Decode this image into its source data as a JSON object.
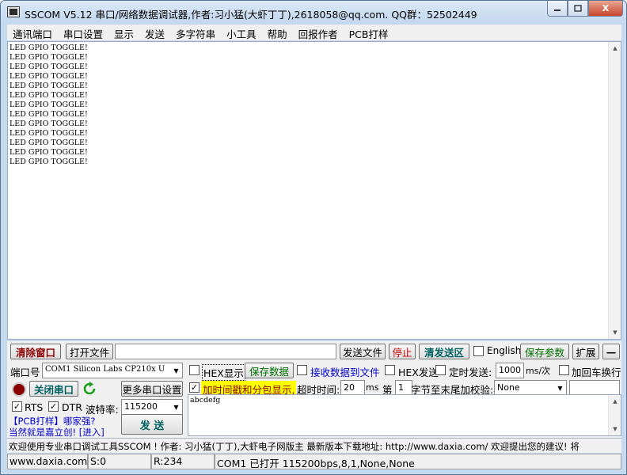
{
  "window": {
    "title": "SSCOM V5.12 串口/网络数据调试器,作者:习小猛(大虾丁丁),2618058@qq.com. QQ群：52502449",
    "minimize_icon": "minimize-icon",
    "maximize_icon": "maximize-icon",
    "close_label": "X"
  },
  "menu": [
    "通讯端口",
    "串口设置",
    "显示",
    "发送",
    "多字符串",
    "小工具",
    "帮助",
    "回报作者",
    "PCB打样"
  ],
  "receive": {
    "lines": [
      "LED GPIO TOGGLE!",
      "LED GPIO TOGGLE!",
      "LED GPIO TOGGLE!",
      "LED GPIO TOGGLE!",
      "LED GPIO TOGGLE!",
      "LED GPIO TOGGLE!",
      "LED GPIO TOGGLE!",
      "LED GPIO TOGGLE!",
      "LED GPIO TOGGLE!",
      "LED GPIO TOGGLE!",
      "LED GPIO TOGGLE!",
      "LED GPIO TOGGLE!",
      "LED GPIO TOGGLE!"
    ]
  },
  "row1": {
    "clear_window": "清除窗口",
    "open_file": "打开文件",
    "file_path": "",
    "send_file": "发送文件",
    "stop": "停止",
    "clear_send": "清发送区",
    "english": "English",
    "save_params": "保存参数",
    "expand": "扩展",
    "collapse": "—"
  },
  "row2": {
    "port_label": "端口号",
    "port_value": "COM1 Silicon Labs CP210x U",
    "hex_display": "HEX显示",
    "save_data": "保存数据",
    "recv_to_file": "接收数据到文件",
    "hex_send": "HEX发送",
    "timed_send": "定时发送:",
    "interval_value": "1000",
    "interval_unit": "ms/次",
    "add_crlf": "加回车换行"
  },
  "row3": {
    "close_port": "关闭串口",
    "more_settings": "更多串口设置",
    "timestamp_label": "加时间戳和分包显示,",
    "timeout_label": "超时时间:",
    "timeout_value": "20",
    "timeout_unit": "ms",
    "nth_label": "第",
    "nth_value": "1",
    "byte_to_end": "字节至末尾加校验:",
    "checksum_value": "None",
    "checksum_extra": ""
  },
  "row4": {
    "rts": "RTS",
    "dtr": "DTR",
    "baud_label": "波特率:",
    "baud_value": "115200",
    "send_text": "abcdefg"
  },
  "promo": {
    "line1": "【PCB打样】哪家强?",
    "line2": "当然就是嘉立创! [进入]",
    "send": "发  送"
  },
  "status1": "欢迎使用专业串口调试工具SSCOM ! 作者: 习小猛(丁丁),大虾电子网版主  最新版本下载地址: http://www.daxia.com/ 欢迎提出您的建议! 将",
  "status2": {
    "site": "www.daxia.com",
    "sent": "S:0",
    "received": "R:234",
    "port_state": "COM1 已打开  115200bps,8,1,None,None"
  },
  "colors": {
    "title_bg": "#c5d9ef",
    "highlight_yellow": "#ffff00",
    "link_blue": "#0000cc",
    "green_text": "#007000",
    "teal_text": "#006060",
    "dark_red_text": "#8b0000"
  }
}
